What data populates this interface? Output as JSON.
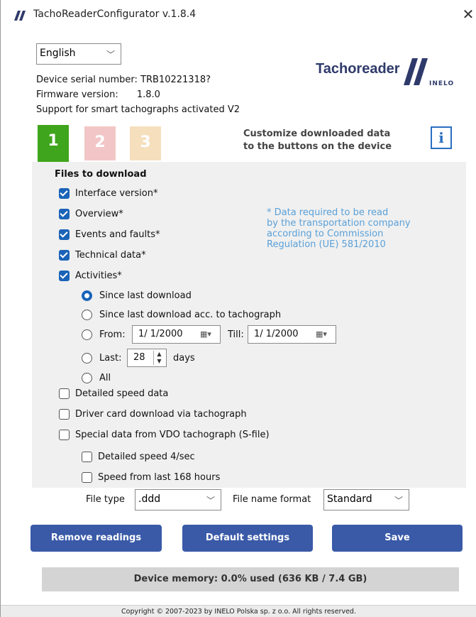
{
  "window": {
    "title": "TachoReaderConfigurator v.1.8.4",
    "close_glyph": "✕"
  },
  "header": {
    "language": "English",
    "serial_label": "Device serial number:",
    "serial_value": "TRB10221318?",
    "firmware_label": "Firmware version:",
    "firmware_value": "1.8.0",
    "smart_support": "Support for smart tachographs activated V2",
    "brand": "Tachoreader",
    "brand_sub": "INELO",
    "brand_color": "#2f3a6b"
  },
  "tabs": [
    {
      "label": "1",
      "color": "#3fa51c",
      "active": true
    },
    {
      "label": "2",
      "color": "#f2c6c6",
      "active": false
    },
    {
      "label": "3",
      "color": "#f6dfbd",
      "active": false
    }
  ],
  "customize_text_1": "Customize downloaded data",
  "customize_text_2": "to the buttons on the device",
  "info_glyph": "i",
  "files": {
    "heading": "Files to download",
    "items": [
      {
        "label": "Interface version*",
        "checked": true
      },
      {
        "label": "Overview*",
        "checked": true
      },
      {
        "label": "Events and faults*",
        "checked": true
      },
      {
        "label": "Technical data*",
        "checked": true
      },
      {
        "label": "Activities*",
        "checked": true
      }
    ],
    "note": [
      "* Data required to be read",
      "by the transportation company",
      "according to Commission",
      "Regulation (UE) 581/2010"
    ],
    "note_color": "#5aa0d8"
  },
  "activities": {
    "since_last": "Since last download",
    "since_last_tacho": "Since last download acc. to tachograph",
    "from_label": "From:",
    "from_value": "1/  1/2000",
    "till_label": "Till:",
    "till_value": "1/  1/2000",
    "last_label": "Last:",
    "last_value": "28",
    "days_label": "days",
    "all_label": "All",
    "selected": "since_last"
  },
  "extra": {
    "detailed_speed": "Detailed speed data",
    "driver_card": "Driver card download via tachograph",
    "special_vdo": "Special data from VDO tachograph (S-file)",
    "speed_4sec": "Detailed speed 4/sec",
    "speed_168h": "Speed from last 168 hours"
  },
  "filetype": {
    "label": "File type",
    "value": ".ddd",
    "name_format_label": "File name format",
    "name_format_value": "Standard"
  },
  "buttons": {
    "remove": "Remove readings",
    "defaults": "Default settings",
    "save": "Save",
    "color": "#3a5aa8"
  },
  "memory": "Device memory: 0.0% used (636 KB / 7.4 GB)",
  "footer": "Copyright © 2007-2023 by INELO Polska sp. z o.o. All rights reserved."
}
